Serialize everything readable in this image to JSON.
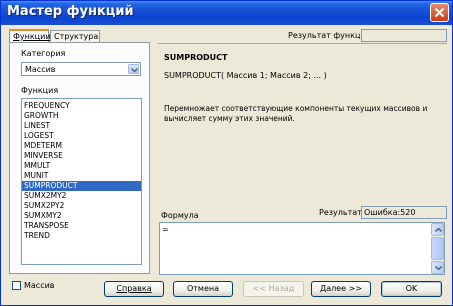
{
  "window": {
    "title": "Мастер функций"
  },
  "tabs": [
    {
      "label": "Функции"
    },
    {
      "label": "Структура"
    }
  ],
  "category": {
    "label": "Категория",
    "selected": "Массив"
  },
  "function_list": {
    "label": "Функция",
    "items": [
      "FREQUENCY",
      "GROWTH",
      "LINEST",
      "LOGEST",
      "MDETERM",
      "MINVERSE",
      "MMULT",
      "MUNIT",
      "SUMPRODUCT",
      "SUMX2MY2",
      "SUMX2PY2",
      "SUMXMY2",
      "TRANSPOSE",
      "TREND"
    ],
    "selected_index": 8
  },
  "function_result": {
    "label": "Результат функции",
    "value": ""
  },
  "function_info": {
    "name": "SUMPRODUCT",
    "signature": "SUMPRODUCT( Массив 1; Массив 2; ... )",
    "description": "Перемножает соответствующие компоненты текущих массивов и вычисляет сумму этих значений."
  },
  "result": {
    "label": "Результат",
    "value": "Ошибка:520"
  },
  "formula": {
    "label": "Формула",
    "value": "="
  },
  "array_checkbox": {
    "label": "Массив",
    "checked": false
  },
  "buttons": {
    "help": "Справка",
    "cancel": "Отмена",
    "back": "<< Назад",
    "next": "Далее >>",
    "ok": "OK"
  },
  "colors": {
    "titlebar": "#0b44cf",
    "selection": "#316ac5",
    "dialog_bg": "#ece9d8"
  }
}
